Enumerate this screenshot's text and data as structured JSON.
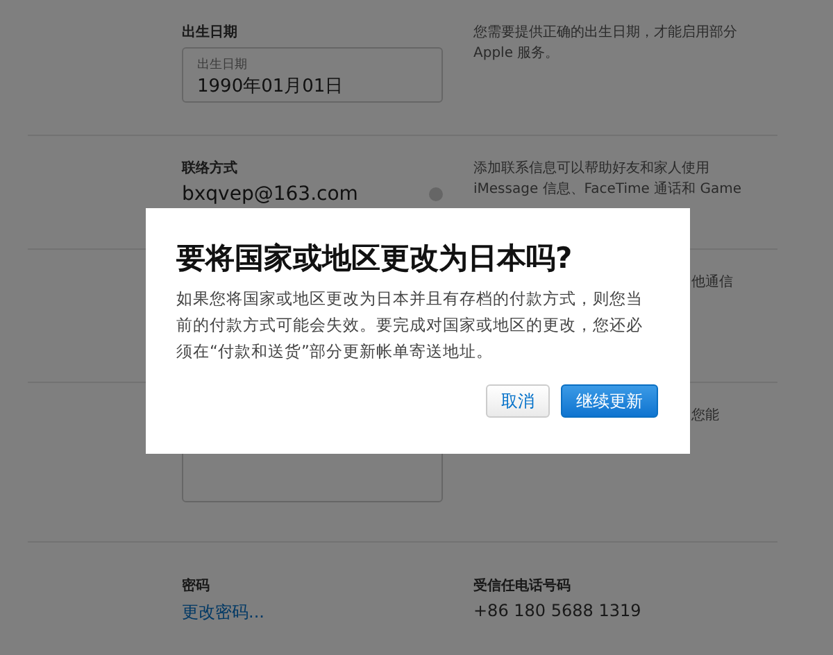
{
  "sections": [
    {
      "label": "出生日期",
      "field": {
        "label": "出生日期",
        "value": "1990年01月01日"
      },
      "info": "您需要提供正确的出生日期，才能启用部分 Apple 服务。"
    },
    {
      "label": "联络方式",
      "email": "bxqvep@163.com",
      "info": "添加联系信息可以帮助好友和家人使用 iMessage 信息、FaceTime 通话和 Game"
    }
  ],
  "partial_texts": [
    "他通信",
    "您能"
  ],
  "security": [
    {
      "label": "密码",
      "value": "更改密码...",
      "kind": "link"
    },
    {
      "label": "受信任电话号码",
      "value": "+86 180 5688 1319",
      "kind": "text"
    }
  ],
  "dialog": {
    "title": "要将国家或地区更改为日本吗?",
    "message": "如果您将国家或地区更改为日本并且有存档的付款方式，则您当前的付款方式可能会失效。要完成对国家或地区的更改，您还必须在“付款和送货”部分更新帐单寄送地址。",
    "buttons": [
      {
        "label": "取消",
        "primary": false
      },
      {
        "label": "继续更新",
        "primary": true
      }
    ]
  }
}
